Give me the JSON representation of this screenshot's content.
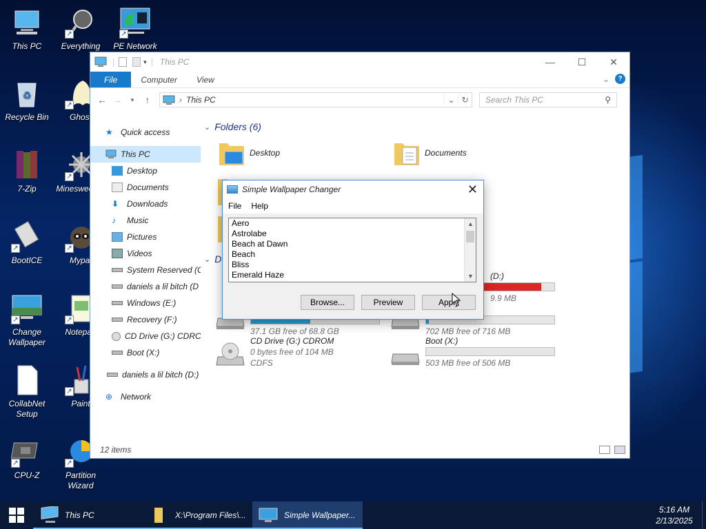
{
  "desktop": {
    "icons": [
      {
        "label": "This PC",
        "icon": "monitor-icon"
      },
      {
        "label": "Everything",
        "icon": "magnifier-icon"
      },
      {
        "label": "PE Network",
        "icon": "network-monitor-icon"
      },
      {
        "label": "Recycle Bin",
        "icon": "recycle-bin-icon"
      },
      {
        "label": "Ghost",
        "icon": "ghost-icon"
      },
      {
        "label": "7-Zip",
        "icon": "archive-books-icon"
      },
      {
        "label": "Minesweeper",
        "icon": "mine-icon"
      },
      {
        "label": "BootICE",
        "icon": "usb-drive-icon"
      },
      {
        "label": "Mypal",
        "icon": "raccoon-icon"
      },
      {
        "label": "Change Wallpaper",
        "icon": "wallpaper-icon"
      },
      {
        "label": "Notepad",
        "icon": "notepad-icon"
      },
      {
        "label": "CollabNet Setup",
        "icon": "document-icon"
      },
      {
        "label": "Paint",
        "icon": "paint-brushes-icon"
      },
      {
        "label": "CPU-Z",
        "icon": "cpu-chip-icon"
      },
      {
        "label": "Partition Wizard",
        "icon": "partition-wizard-icon"
      }
    ]
  },
  "explorer": {
    "title": "This PC",
    "ribbon_tabs": [
      "File",
      "Computer",
      "View"
    ],
    "address": "This PC",
    "search_placeholder": "Search This PC",
    "nav": [
      {
        "label": "Quick access",
        "icon": "star-icon"
      },
      {
        "label": "This PC",
        "icon": "monitor-icon"
      },
      {
        "label": "Desktop",
        "icon": "desktop-folder-icon"
      },
      {
        "label": "Documents",
        "icon": "documents-icon"
      },
      {
        "label": "Downloads",
        "icon": "download-arrow-icon"
      },
      {
        "label": "Music",
        "icon": "music-note-icon"
      },
      {
        "label": "Pictures",
        "icon": "pictures-icon"
      },
      {
        "label": "Videos",
        "icon": "videos-icon"
      },
      {
        "label": "System Reserved (C:",
        "icon": "drive-icon"
      },
      {
        "label": "daniels a lil bitch (D",
        "icon": "drive-icon"
      },
      {
        "label": "Windows (E:)",
        "icon": "drive-icon"
      },
      {
        "label": "Recovery (F:)",
        "icon": "drive-icon"
      },
      {
        "label": "CD Drive (G:) CDRC",
        "icon": "cd-drive-icon"
      },
      {
        "label": "Boot (X:)",
        "icon": "drive-icon"
      },
      {
        "label": "daniels a lil bitch (D:)",
        "icon": "drive-icon"
      },
      {
        "label": "Network",
        "icon": "network-icon"
      }
    ],
    "folders_header": "Folders (6)",
    "devices_header_partial": "D",
    "folders": [
      {
        "label": "Desktop"
      },
      {
        "label": "Documents"
      }
    ],
    "drives": [
      {
        "name": "(D:)",
        "free": "9.9 MB",
        "fill_fraction": 0.9,
        "critical": true
      },
      {
        "name": "",
        "free": "37.1 GB free of 68.8 GB",
        "fill_fraction": 0.46,
        "critical": false
      },
      {
        "name": "",
        "free": "702 MB free of 716 MB",
        "fill_fraction": 0.02,
        "critical": false
      },
      {
        "name": "CD Drive (G:) CDROM",
        "free": "0 bytes free of 104 MB",
        "fs": "CDFS"
      },
      {
        "name": "Boot (X:)",
        "free": "503 MB free of 506 MB",
        "fill_fraction": 0.0,
        "critical": false
      }
    ],
    "status": "12 items"
  },
  "dialog": {
    "title": "Simple Wallpaper Changer",
    "menu": [
      "File",
      "Help"
    ],
    "list": [
      "Aero",
      "Astrolabe",
      "Beach at Dawn",
      "Beach",
      "Bliss",
      "Emerald Haze"
    ],
    "buttons": {
      "browse": "Browse...",
      "preview": "Preview",
      "apply": "Apply"
    }
  },
  "taskbar": {
    "items": [
      {
        "label": "This PC"
      },
      {
        "label": "X:\\Program Files\\..."
      },
      {
        "label": "Simple Wallpaper..."
      }
    ],
    "time": "5:16 AM",
    "date": "2/13/2025"
  },
  "colors": {
    "accent": "#1979ca",
    "progress": "#26a0da",
    "critical": "#da2626"
  }
}
